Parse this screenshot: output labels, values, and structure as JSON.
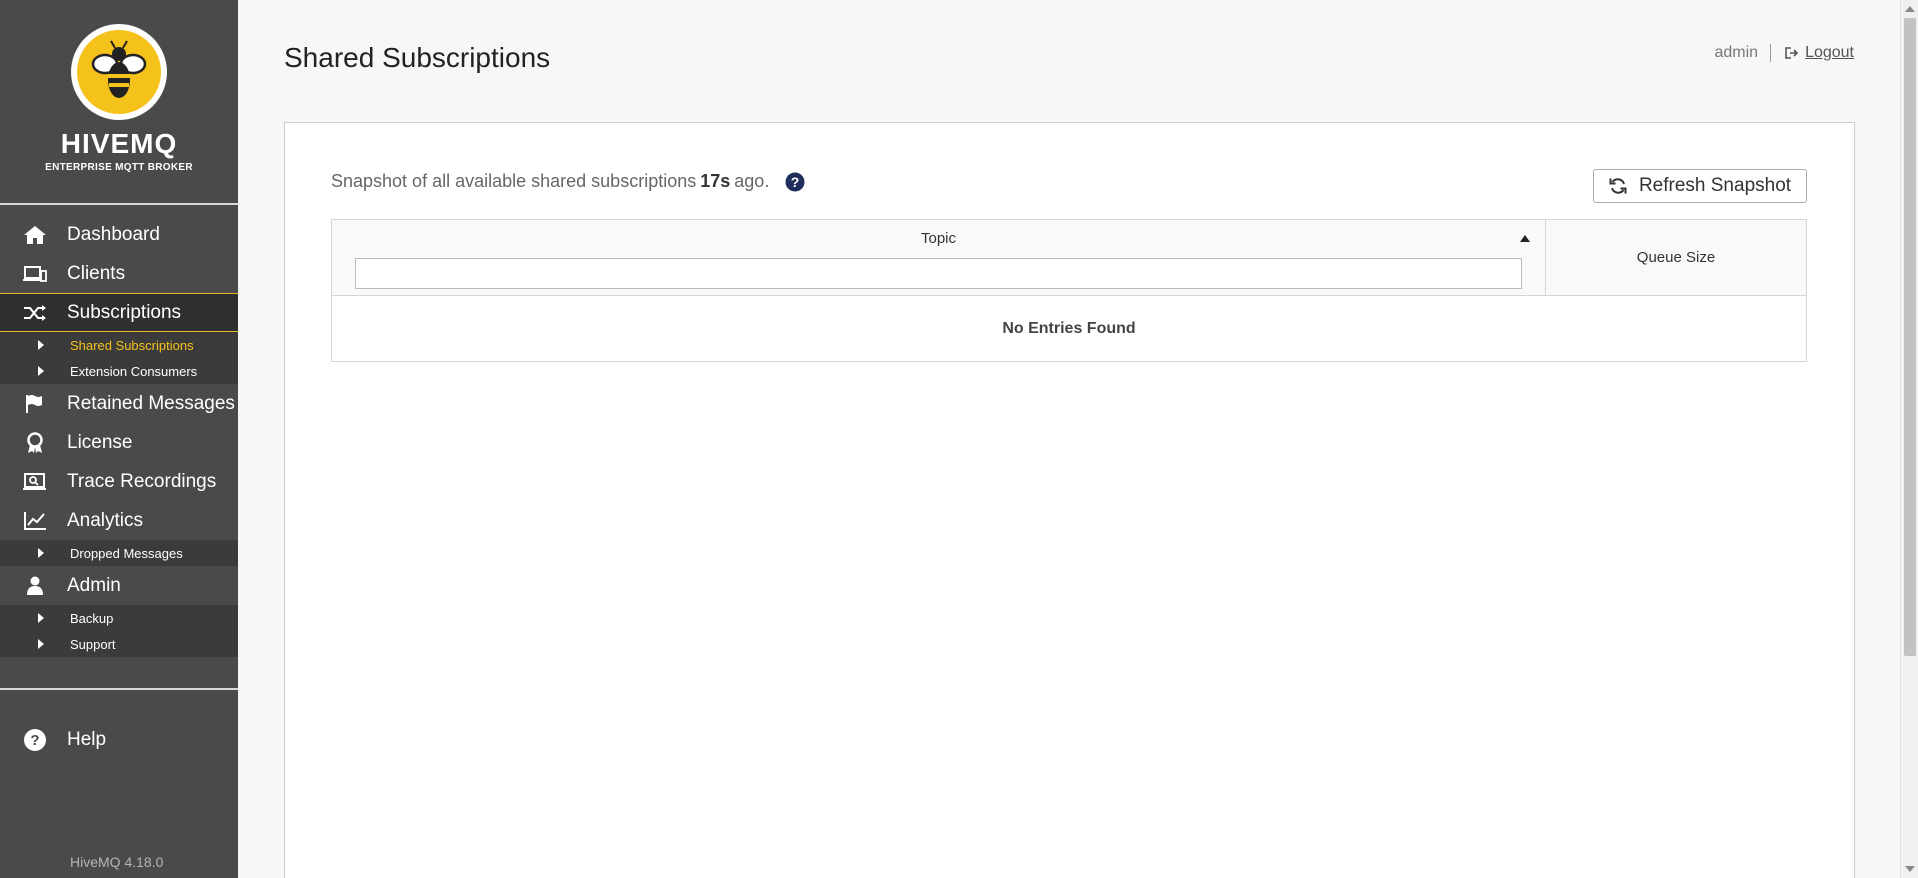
{
  "brand": {
    "name": "HIVEMQ",
    "tagline": "ENTERPRISE MQTT BROKER",
    "version": "HiveMQ 4.18.0",
    "accent": "#f5c21b"
  },
  "sidebar": {
    "items": [
      {
        "label": "Dashboard",
        "icon": "home-icon"
      },
      {
        "label": "Clients",
        "icon": "clients-icon"
      },
      {
        "label": "Subscriptions",
        "icon": "shuffle-icon",
        "active": true,
        "children": [
          {
            "label": "Shared Subscriptions",
            "active": true
          },
          {
            "label": "Extension Consumers"
          }
        ]
      },
      {
        "label": "Retained Messages",
        "icon": "flag-icon"
      },
      {
        "label": "License",
        "icon": "award-icon"
      },
      {
        "label": "Trace Recordings",
        "icon": "trace-icon"
      },
      {
        "label": "Analytics",
        "icon": "chart-icon",
        "children": [
          {
            "label": "Dropped Messages"
          }
        ]
      },
      {
        "label": "Admin",
        "icon": "user-icon",
        "children": [
          {
            "label": "Backup"
          },
          {
            "label": "Support"
          }
        ]
      }
    ],
    "help_label": "Help"
  },
  "header": {
    "title": "Shared Subscriptions",
    "user": "admin",
    "logout_label": "Logout"
  },
  "main": {
    "snapshot_prefix": "Snapshot of all available shared subscriptions",
    "snapshot_age": "17s",
    "snapshot_suffix": "ago.",
    "refresh_label": "Refresh Snapshot",
    "table": {
      "columns": [
        "Topic",
        "Queue Size"
      ],
      "filter_value": "",
      "empty_message": "No Entries Found"
    }
  }
}
